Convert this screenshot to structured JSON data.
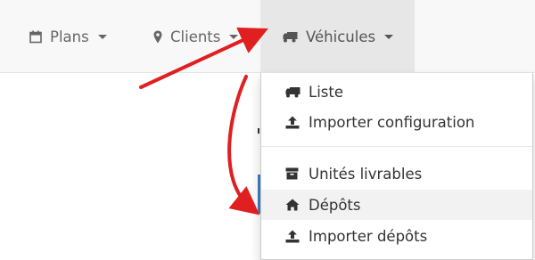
{
  "navbar": {
    "items": [
      {
        "label": "Plans",
        "icon": "calendar-icon"
      },
      {
        "label": "Clients",
        "icon": "map-marker-icon"
      },
      {
        "label": "Véhicules",
        "icon": "truck-icon",
        "active": true
      }
    ]
  },
  "dropdown": {
    "items": [
      {
        "label": "Liste",
        "icon": "truck-icon"
      },
      {
        "label": "Importer configuration",
        "icon": "upload-icon"
      },
      {
        "label": "Unités livrables",
        "icon": "archive-icon"
      },
      {
        "label": "Dépôts",
        "icon": "home-icon",
        "highlighted": true
      },
      {
        "label": "Importer dépôts",
        "icon": "upload-icon"
      }
    ]
  },
  "annotations": {
    "arrow_color": "#e02020"
  }
}
